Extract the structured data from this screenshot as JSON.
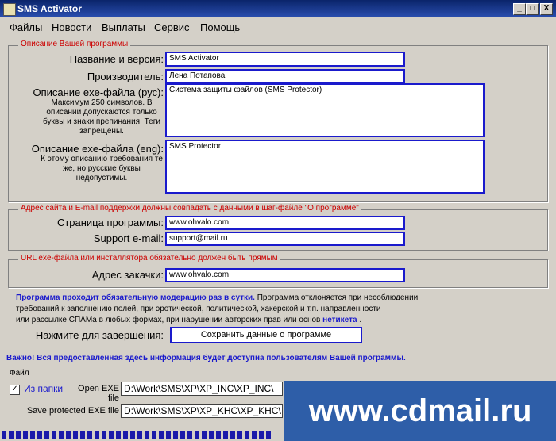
{
  "window": {
    "title": "SMS Activator",
    "controls": [
      "_",
      "□",
      "X"
    ]
  },
  "menu": [
    "Файлы",
    "Новости",
    "Выплаты",
    "Сервис",
    "Помощь"
  ],
  "section1": {
    "legend": "Описание Вашей программы",
    "name_label": "Название и версия:",
    "name_value": "SMS Activator",
    "producer_label": "Производитель:",
    "producer_value": "Лена Потапова",
    "desc_rus_label": "Описание exe-файла (рус):",
    "desc_rus_hint": "Максимум 250 символов. В описании допускаются только буквы и знаки препинания. Теги запрещены.",
    "desc_rus_value": "Система защиты файлов (SMS Protector)",
    "desc_eng_label": "Описание exe-файла (eng):",
    "desc_eng_hint": "К этому описанию требования те же, но русские буквы недопустимы.",
    "desc_eng_value": "SMS Protector"
  },
  "section2": {
    "legend": "Адрес сайта и E-mail поддержки должны совпадать с данными в шаг-файле \"О программе\"",
    "page_label": "Страница программы:",
    "page_value": "www.ohvalo.com",
    "email_label": "Support e-mail:",
    "email_value": "support@mail.ru"
  },
  "section3": {
    "legend": "URL exe-файла или инсталлятора обязательно должен быть прямым",
    "url_label": "Адрес закачки:",
    "url_value": "www.ohvalo.com"
  },
  "notice": {
    "line1_blue": "Программа проходит обязательную модерацию раз в сутки.",
    "line1_rest": "Программа отклоняется при несоблюдении",
    "line2": "требований к заполнению полей, при эротической, политической, хакерской и т.п. направленности",
    "line3_start": "или рассылке СПАМа в любых формах, при нарушении авторских прав или основ",
    "line3_link": "нетикета",
    "line3_end": "."
  },
  "finish": {
    "label": "Нажмите для завершения:",
    "button": "Сохранить данные о программе"
  },
  "warning": "Важно! Вся предоставленная здесь информация будет доступна пользователям Вашей программы.",
  "bottom": {
    "group_label": "Файл",
    "check_label": "Из папки",
    "open_label": "Open EXE file",
    "open_value": "D:\\Work\\SMS\\XP\\XP_INC\\XP_INC\\",
    "save_label": "Save protected EXE file",
    "save_value": "D:\\Work\\SMS\\XP\\XP_KHC\\XP_KHC\\"
  },
  "progress": {
    "fraction": 0.5
  },
  "watermark": "www.cdmail.ru"
}
